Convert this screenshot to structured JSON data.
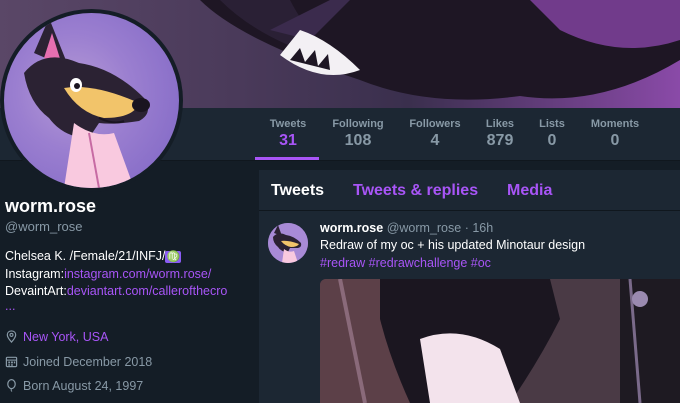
{
  "stats": [
    {
      "label": "Tweets",
      "value": "31"
    },
    {
      "label": "Following",
      "value": "108"
    },
    {
      "label": "Followers",
      "value": "4"
    },
    {
      "label": "Likes",
      "value": "879"
    },
    {
      "label": "Lists",
      "value": "0"
    },
    {
      "label": "Moments",
      "value": "0"
    }
  ],
  "profile": {
    "name": "worm.rose",
    "handle": "@worm_rose",
    "bio_line1": "Chelsea K. /Female/21/INFJ/",
    "zodiac": "♍",
    "instagram_label": "Instagram:",
    "instagram_link": "instagram.com/worm.rose/",
    "devaintart_label": "DevaintArt:",
    "devaintart_link": "deviantart.com/callerofthecro",
    "bio_more": "...",
    "location": "New York, USA",
    "joined": "Joined December 2018",
    "born": "Born August 24, 1997"
  },
  "tabs": [
    "Tweets",
    "Tweets & replies",
    "Media"
  ],
  "tweet": {
    "name": "worm.rose",
    "handle_time": "@worm_rose · 16h",
    "text": "Redraw of my oc + his updated Minotaur design",
    "tags": "#redraw #redrawchallenge #oc"
  },
  "colors": {
    "accent": "#a855f7",
    "bg": "#141d26",
    "panel": "#1c2733",
    "muted": "#8899a6"
  },
  "icons": [
    "location-pin-icon",
    "calendar-icon",
    "birthday-balloon-icon"
  ]
}
